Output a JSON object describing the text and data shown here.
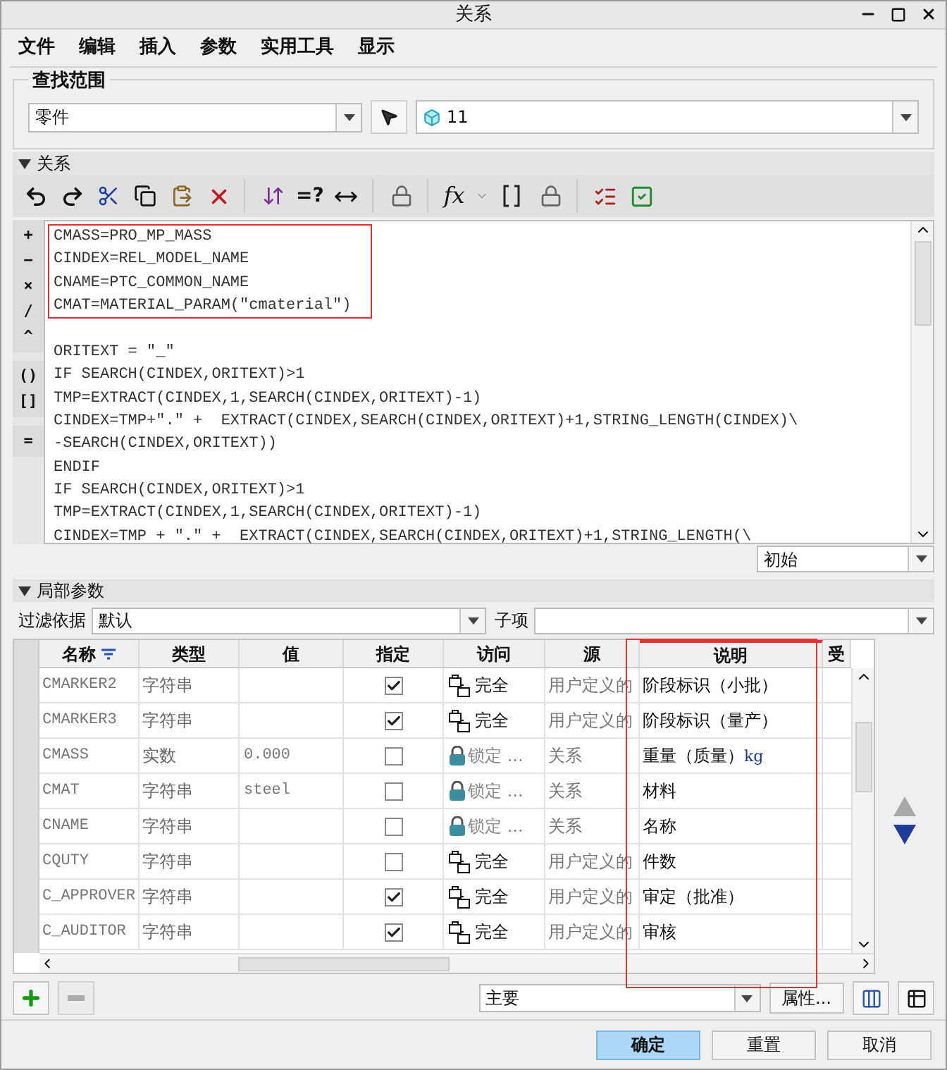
{
  "window": {
    "title": "关系"
  },
  "menu": [
    "文件",
    "编辑",
    "插入",
    "参数",
    "实用工具",
    "显示"
  ],
  "search_scope": {
    "label": "查找范围",
    "type_value": "零件",
    "model_value": "11"
  },
  "relations": {
    "label": "关系",
    "expanded": true,
    "check_label": "=?",
    "function_label": "fx",
    "operator_groups": [
      [
        "+",
        "−",
        "×",
        "/",
        "^"
      ],
      [
        "()",
        "[]"
      ],
      [
        "="
      ]
    ],
    "highlighted_lines": [
      "CMASS=PRO_MP_MASS",
      "CINDEX=REL_MODEL_NAME",
      "CNAME=PTC_COMMON_NAME",
      "CMAT=MATERIAL_PARAM(\"cmaterial\")"
    ],
    "lines": [
      "ORITEXT = \"_\"",
      "IF SEARCH(CINDEX,ORITEXT)>1",
      "TMP=EXTRACT(CINDEX,1,SEARCH(CINDEX,ORITEXT)-1)",
      "CINDEX=TMP+\".\" +  EXTRACT(CINDEX,SEARCH(CINDEX,ORITEXT)+1,STRING_LENGTH(CINDEX)\\",
      "-SEARCH(CINDEX,ORITEXT))",
      "ENDIF",
      "IF SEARCH(CINDEX,ORITEXT)>1",
      "TMP=EXTRACT(CINDEX,1,SEARCH(CINDEX,ORITEXT)-1)",
      "CINDEX=TMP + \".\" +  EXTRACT(CINDEX,SEARCH(CINDEX,ORITEXT)+1,STRING_LENGTH(\\"
    ],
    "view": "初始"
  },
  "local_params": {
    "label": "局部参数",
    "expanded": true,
    "filter_label": "过滤依据",
    "filter_value": "默认",
    "child_label": "子项",
    "columns": [
      {
        "label": "名称",
        "sorted": true,
        "highlighted": false
      },
      {
        "label": "类型",
        "sorted": false,
        "highlighted": false
      },
      {
        "label": "值",
        "sorted": false,
        "highlighted": false
      },
      {
        "label": "指定",
        "sorted": false,
        "highlighted": false
      },
      {
        "label": "访问",
        "sorted": false,
        "highlighted": false
      },
      {
        "label": "源",
        "sorted": false,
        "highlighted": false
      },
      {
        "label": "说明",
        "sorted": false,
        "highlighted": true
      },
      {
        "label": "受",
        "sorted": false,
        "highlighted": false
      }
    ],
    "rows": [
      {
        "name": "CMARKER2",
        "type": "字符串",
        "value": "",
        "checked": true,
        "access": {
          "kind": "full",
          "label": "完全"
        },
        "source": "用户定义的",
        "description": "阶段标识（小批）"
      },
      {
        "name": "CMARKER3",
        "type": "字符串",
        "value": "",
        "checked": true,
        "access": {
          "kind": "full",
          "label": "完全"
        },
        "source": "用户定义的",
        "description": "阶段标识（量产）"
      },
      {
        "name": "CMASS",
        "type": "实数",
        "value": "0.000",
        "checked": false,
        "access": {
          "kind": "locked",
          "label": "锁定 ..."
        },
        "source": "关系",
        "description": "重量（质量）",
        "unit": "kg"
      },
      {
        "name": "CMAT",
        "type": "字符串",
        "value": "steel",
        "checked": false,
        "access": {
          "kind": "locked",
          "label": "锁定 ..."
        },
        "source": "关系",
        "description": "材料"
      },
      {
        "name": "CNAME",
        "type": "字符串",
        "value": "",
        "checked": false,
        "access": {
          "kind": "locked",
          "label": "锁定 ..."
        },
        "source": "关系",
        "description": "名称"
      },
      {
        "name": "CQUTY",
        "type": "字符串",
        "value": "",
        "checked": false,
        "access": {
          "kind": "full",
          "label": "完全"
        },
        "source": "用户定义的",
        "description": "件数"
      },
      {
        "name": "C_APPROVER",
        "type": "字符串",
        "value": "",
        "checked": true,
        "access": {
          "kind": "full",
          "label": "完全"
        },
        "source": "用户定义的",
        "description": "审定（批准）"
      },
      {
        "name": "C_AUDITOR",
        "type": "字符串",
        "value": "",
        "checked": true,
        "access": {
          "kind": "full",
          "label": "完全"
        },
        "source": "用户定义的",
        "description": "审核"
      }
    ],
    "view": "主要",
    "properties_button": "属性..."
  },
  "buttons": [
    {
      "label": "确定",
      "primary": true
    },
    {
      "label": "重置",
      "primary": false
    },
    {
      "label": "取消",
      "primary": false
    }
  ]
}
